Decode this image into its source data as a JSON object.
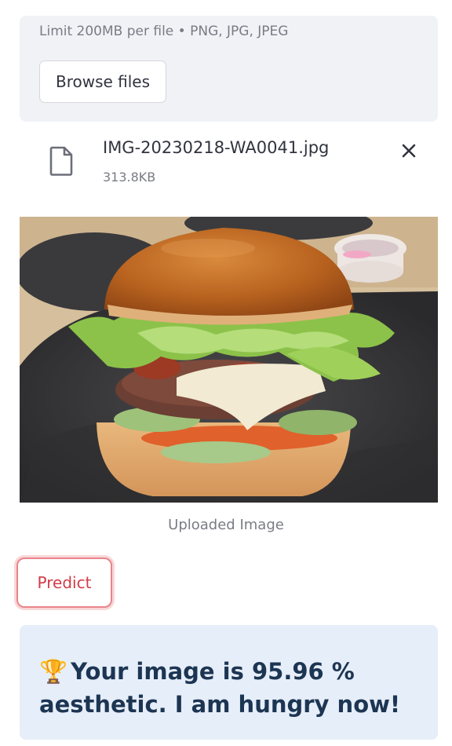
{
  "uploader": {
    "limit_text": "Limit 200MB per file • PNG, JPG, JPEG",
    "browse_label": "Browse files"
  },
  "file": {
    "name": "IMG-20230218-WA0041.jpg",
    "size": "313.8KB",
    "file_icon": "file-icon",
    "remove_icon": "close-icon"
  },
  "image": {
    "caption": "Uploaded Image"
  },
  "predict": {
    "label": "Predict"
  },
  "result": {
    "icon": "🏆",
    "text": "Your image is 95.96 % aesthetic. I am hungry now!"
  },
  "colors": {
    "accent": "#d23b47",
    "info_bg": "#e6eef9",
    "uploader_bg": "#f0f2f6"
  }
}
